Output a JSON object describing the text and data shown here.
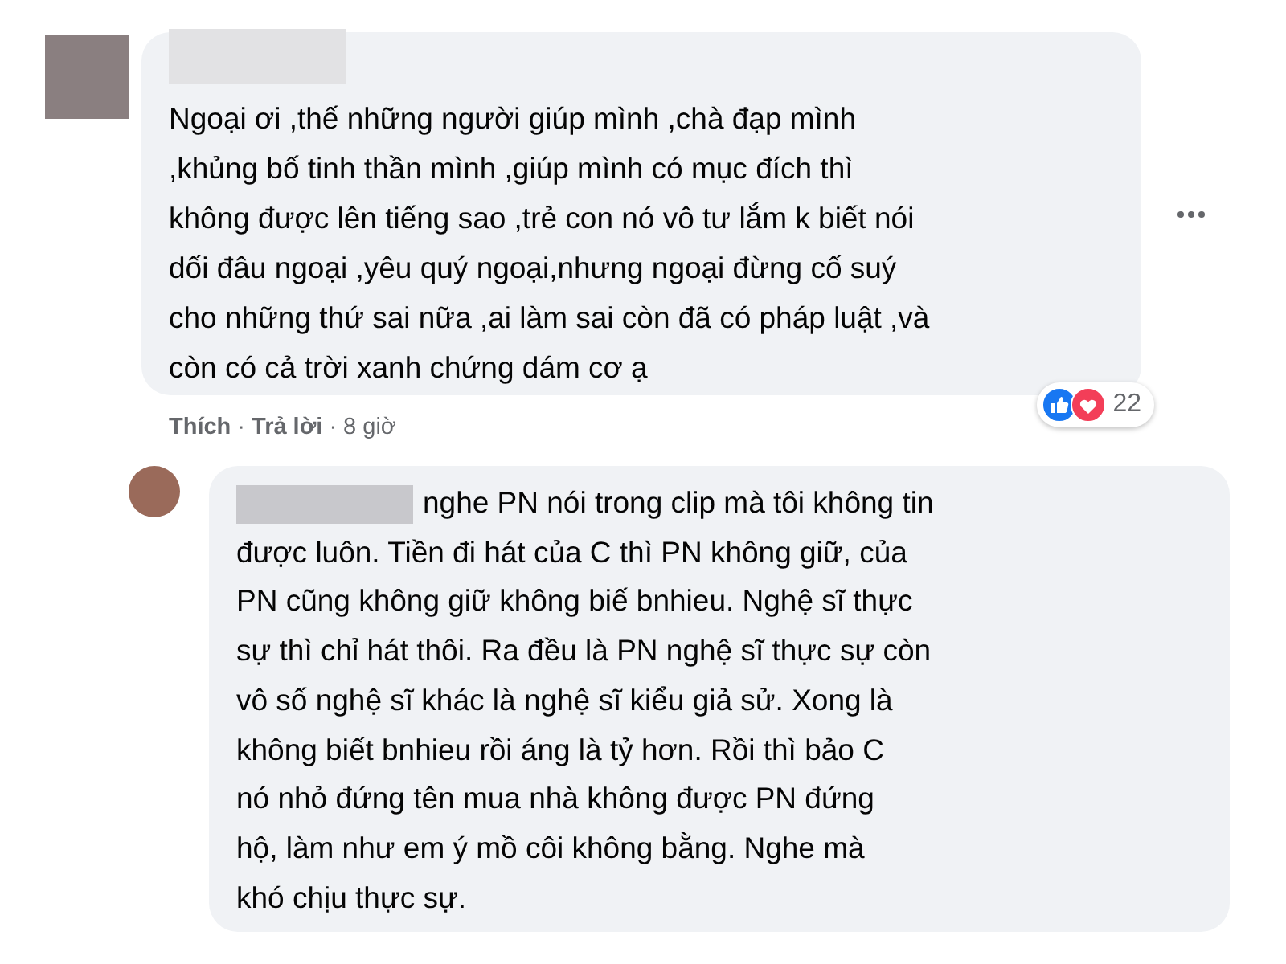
{
  "comments": [
    {
      "text": "Ngoại ơi ,thế những người giúp mình ,chà đạp mình\n,khủng bố tinh thần mình ,giúp mình có mục đích thì\nkhông được lên tiếng sao ,trẻ con nó vô tư lắm k biết nói\ndối đâu ngoại ,yêu quý ngoại,nhưng ngoại đừng cố suý\ncho những thứ sai nữa ,ai làm sai còn đã có pháp luật ,và\ncòn có cả trời xanh chứng dám cơ ạ",
      "actions": [
        "Thích",
        "Trả lời"
      ],
      "separator": "·",
      "time": "8 giờ",
      "reaction_count": "22",
      "replies": [
        {
          "text": "nghe PN nói trong clip mà tôi không tin\nđược luôn. Tiền đi hát của C thì PN không giữ, của\nPN cũng không giữ không biế bnhieu. Nghệ sĩ thực\nsự thì chỉ hát thôi. Ra đều là PN nghệ sĩ thực sự còn\nvô số nghệ sĩ khác là nghệ sĩ kiểu giả sử. Xong là\nkhông biết bnhieu rồi áng là tỷ hơn. Rồi thì bảo C\nnó nhỏ đứng tên mua nhà không được PN đứng\nhộ, làm như em ý mồ côi không bằng. Nghe mà\nkhó chịu thực sự."
        }
      ]
    }
  ]
}
